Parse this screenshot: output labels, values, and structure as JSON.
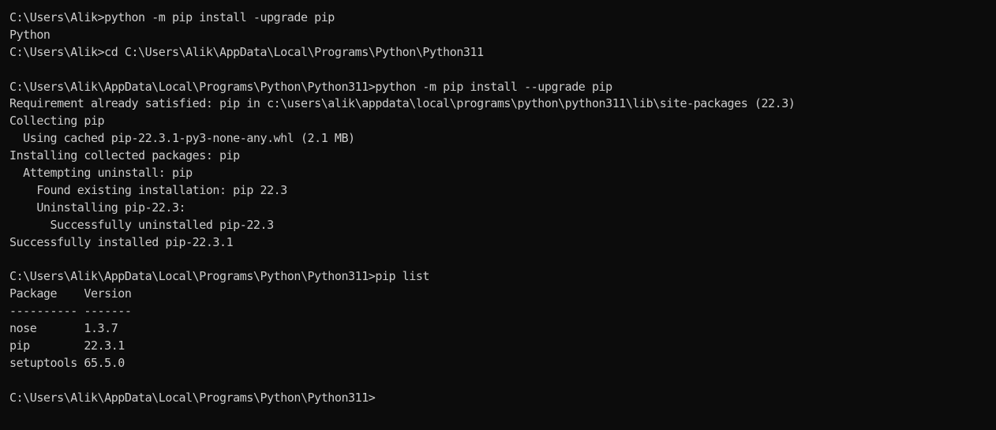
{
  "console": {
    "colors": {
      "background": "#0c0c0c",
      "text": "#cccccc"
    },
    "lines": [
      "C:\\Users\\Alik>python -m pip install -upgrade pip",
      "Python",
      "C:\\Users\\Alik>cd C:\\Users\\Alik\\AppData\\Local\\Programs\\Python\\Python311",
      "",
      "C:\\Users\\Alik\\AppData\\Local\\Programs\\Python\\Python311>python -m pip install --upgrade pip",
      "Requirement already satisfied: pip in c:\\users\\alik\\appdata\\local\\programs\\python\\python311\\lib\\site-packages (22.3)",
      "Collecting pip",
      "  Using cached pip-22.3.1-py3-none-any.whl (2.1 MB)",
      "Installing collected packages: pip",
      "  Attempting uninstall: pip",
      "    Found existing installation: pip 22.3",
      "    Uninstalling pip-22.3:",
      "      Successfully uninstalled pip-22.3",
      "Successfully installed pip-22.3.1",
      "",
      "C:\\Users\\Alik\\AppData\\Local\\Programs\\Python\\Python311>pip list",
      "Package    Version",
      "---------- -------",
      "nose       1.3.7",
      "pip        22.3.1",
      "setuptools 65.5.0",
      "",
      "C:\\Users\\Alik\\AppData\\Local\\Programs\\Python\\Python311>"
    ]
  }
}
